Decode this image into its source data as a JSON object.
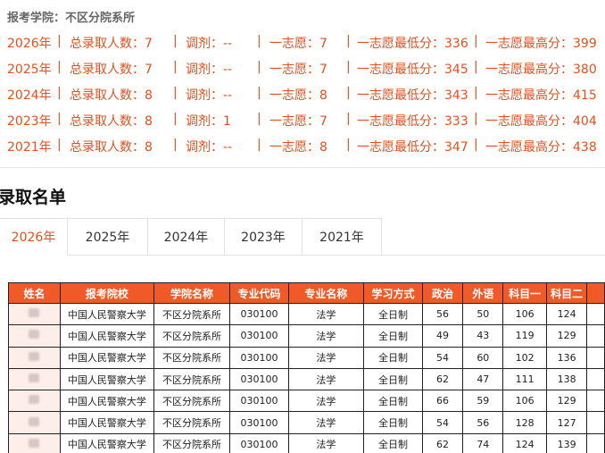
{
  "college_line": "报考学院：不区分院系所",
  "stats": [
    {
      "year": "2026年",
      "total": "总录取人数：7",
      "adjust": "调剂：--",
      "first": "一志愿：7",
      "min": "一志愿最低分：336",
      "max": "一志愿最高分：399"
    },
    {
      "year": "2025年",
      "total": "总录取人数：7",
      "adjust": "调剂：--",
      "first": "一志愿：7",
      "min": "一志愿最低分：345",
      "max": "一志愿最高分：380"
    },
    {
      "year": "2024年",
      "total": "总录取人数：8",
      "adjust": "调剂：--",
      "first": "一志愿：8",
      "min": "一志愿最低分：343",
      "max": "一志愿最高分：415"
    },
    {
      "year": "2023年",
      "total": "总录取人数：8",
      "adjust": "调剂：1",
      "first": "一志愿：7",
      "min": "一志愿最低分：333",
      "max": "一志愿最高分：404"
    },
    {
      "year": "2021年",
      "total": "总录取人数：8",
      "adjust": "调剂：--",
      "first": "一志愿：8",
      "min": "一志愿最低分：347",
      "max": "一志愿最高分：438"
    }
  ],
  "separator": "|",
  "section_title": "录取名单",
  "tabs": [
    "2026年",
    "2025年",
    "2024年",
    "2023年",
    "2021年"
  ],
  "active_tab": 0,
  "table": {
    "headers": [
      "姓名",
      "报考院校",
      "学院名称",
      "专业代码",
      "专业名称",
      "学习方式",
      "政治",
      "外语",
      "科目一",
      "科目二"
    ],
    "rows": [
      [
        "",
        "中国人民警察大学",
        "不区分院系所",
        "030100",
        "法学",
        "全日制",
        "56",
        "50",
        "106",
        "124"
      ],
      [
        "",
        "中国人民警察大学",
        "不区分院系所",
        "030100",
        "法学",
        "全日制",
        "49",
        "43",
        "119",
        "129"
      ],
      [
        "",
        "中国人民警察大学",
        "不区分院系所",
        "030100",
        "法学",
        "全日制",
        "54",
        "60",
        "102",
        "136"
      ],
      [
        "",
        "中国人民警察大学",
        "不区分院系所",
        "030100",
        "法学",
        "全日制",
        "62",
        "47",
        "111",
        "138"
      ],
      [
        "",
        "中国人民警察大学",
        "不区分院系所",
        "030100",
        "法学",
        "全日制",
        "66",
        "59",
        "106",
        "129"
      ],
      [
        "",
        "中国人民警察大学",
        "不区分院系所",
        "030100",
        "法学",
        "全日制",
        "54",
        "56",
        "128",
        "127"
      ],
      [
        "",
        "中国人民警察大学",
        "不区分院系所",
        "030100",
        "法学",
        "全日制",
        "62",
        "74",
        "124",
        "139"
      ]
    ]
  },
  "colors": {
    "accent": "#e5501e",
    "header_bg": "#f05a28",
    "name_cell_bg": "#fdeeea"
  }
}
